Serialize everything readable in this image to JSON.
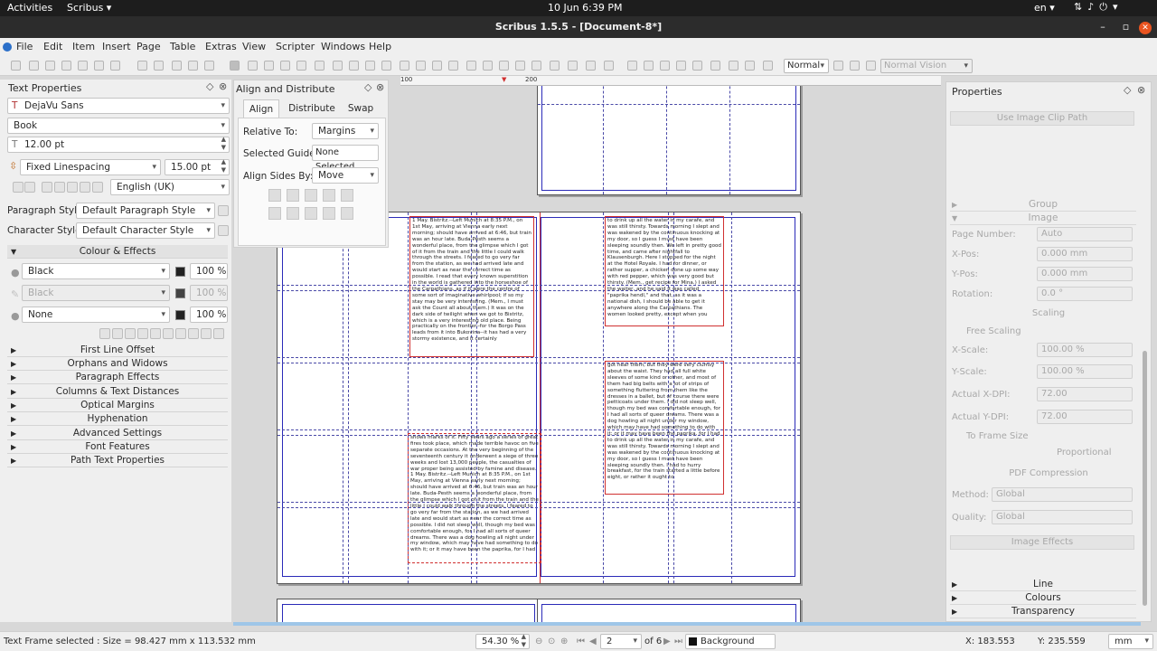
{
  "topbar": {
    "activities": "Activities",
    "app": "Scribus ▾",
    "clock": "10 Jun  6:39 PM",
    "lang": "en ▾",
    "tray_icons": [
      "network-icon",
      "volume-icon",
      "power-icon",
      "menu-caret-icon"
    ]
  },
  "window": {
    "title": "Scribus 1.5.5 - [Document-8*]"
  },
  "menubar": {
    "items": [
      "File",
      "Edit",
      "Item",
      "Insert",
      "Page",
      "Table",
      "Extras",
      "View",
      "Scripter",
      "Windows",
      "Help"
    ]
  },
  "toolbar": {
    "mode_select": "Normal",
    "vision_select": "Normal Vision"
  },
  "text_properties": {
    "title": "Text Properties",
    "font_family": "DejaVu Sans",
    "font_style": "Book",
    "font_size": "12.00 pt",
    "linespacing_mode": "Fixed Linespacing",
    "linespacing_value": "15.00 pt",
    "language": "English (UK)",
    "paragraph_style_label": "Paragraph Style:",
    "paragraph_style": "Default Paragraph Style",
    "character_style_label": "Character Style:",
    "character_style": "Default Character Style",
    "colour_effects": "Colour & Effects",
    "fill_color": "Black",
    "fill_shade": "100 %",
    "stroke_color": "Black",
    "stroke_shade": "100 %",
    "bg_color": "None",
    "bg_shade": "100 %",
    "sections": [
      "First Line Offset",
      "Orphans and Widows",
      "Paragraph Effects",
      "Columns & Text Distances",
      "Optical Margins",
      "Hyphenation",
      "Advanced Settings",
      "Font Features",
      "Path Text Properties"
    ]
  },
  "align_panel": {
    "title": "Align and Distribute",
    "tabs": [
      "Align",
      "Distribute",
      "Swap"
    ],
    "relative_to_label": "Relative To:",
    "relative_to": "Margins",
    "selected_guide_label": "Selected Guide:",
    "selected_guide": "None Selected",
    "align_sides_label": "Align Sides By:",
    "align_sides": "Move"
  },
  "ruler": {
    "ticks": [
      "100",
      "200"
    ]
  },
  "frames": {
    "frame_a": "1 May. Bistritz.--Left Munich at 8:35 P.M., on 1st May, arriving at Vienna early next morning; should have arrived at 6:46, but train was an hour late. Buda-Pesth seems a wonderful place, from the glimpse which I got of it from the train and the little I could walk through the streets. I feared to go very far from the station, as we had arrived late and would start as near the correct time as possible. I read that every known superstition in the world is gathered into the horseshoe of the Carpathians, as if it were the centre of some sort of imaginative whirlpool; if so my stay may be very interesting. (Mem., I must ask the Count all about them.) It was on the dark side of twilight when we got to Bistritz, which is a very interesting old place. Being practically on the frontier--for the Borgo Pass leads from it into Bukovina--it has had a very stormy existence, and it certainly",
    "frame_b": "to drink up all the water in my carafe, and was still thirsty. Towards morning I slept and was wakened by the continuous knocking at my door, so I guess I must have been sleeping soundly then. We left in pretty good time, and came after nightfall to Klausenburgh. Here I stopped for the night at the Hotel Royale. I had for dinner, or rather supper, a chicken done up some way with red pepper, which was very good but thirsty. (Mem., get recipe for Mina.) I asked the waiter, and he said it was called \"paprika hendl,\" and that, as it was a national dish, I should be able to get it anywhere along the Carpathians. The women looked pretty, except when you",
    "frame_c": "got near them, but they were very clumsy about the waist. They had all full white sleeves of some kind or other, and most of them had big belts with a lot of strips of something fluttering from them like the dresses in a ballet, but of course there were petticoats under them. I did not sleep well, though my bed was comfortable enough, for I had all sorts of queer dreams. There was a dog howling all night under my window, which may have had something to do with it; or it may have been the paprika, for I had to drink up all the water in my carafe, and was still thirsty. Towards morning I slept and was wakened by the continuous knocking at my door, so I guess I must have been sleeping soundly then. I had to hurry breakfast, for the train started a little before eight, or rather it ought to",
    "frame_d": "shows marks of it. Fifty years ago a series of great fires took place, which made terrible havoc on five separate occasions. At the very beginning of the seventeenth century it underwent a siege of three weeks and lost 13,000 people, the casualties of war proper being assisted by famine and disease. 1 May. Bistritz.--Left Munich at 8:35 P.M., on 1st May, arriving at Vienna early next morning; should have arrived at 6:46, but train was an hour late. Buda-Pesth seems a wonderful place, from the glimpse which I got of it from the train and the little I could walk through the streets. I feared to go very far from the station, as we had arrived late and would start as near the correct time as possible. I did not sleep well, though my bed was comfortable enough, for I had all sorts of queer dreams. There was a dog howling all night under my window, which may have had something to do with it; or it may have been the paprika, for I had"
  },
  "properties": {
    "title": "Properties",
    "use_clip_path": "Use Image Clip Path",
    "group": "Group",
    "image": "Image",
    "page_number_label": "Page Number:",
    "page_number": "Auto",
    "xpos_label": "X-Pos:",
    "xpos": "0.000 mm",
    "ypos_label": "Y-Pos:",
    "ypos": "0.000 mm",
    "rotation_label": "Rotation:",
    "rotation": "0.0 °",
    "scaling": "Scaling",
    "free_scaling": "Free Scaling",
    "xscale_label": "X-Scale:",
    "xscale": "100.00 %",
    "yscale_label": "Y-Scale:",
    "yscale": "100.00 %",
    "actual_xdpi_label": "Actual X-DPI:",
    "actual_xdpi": "72.00",
    "actual_ydpi_label": "Actual Y-DPI:",
    "actual_ydpi": "72.00",
    "to_frame_size": "To Frame Size",
    "proportional": "Proportional",
    "pdf_compression": "PDF Compression",
    "method_label": "Method:",
    "method": "Global",
    "quality_label": "Quality:",
    "quality": "Global",
    "image_effects": "Image Effects",
    "sections": [
      "Line",
      "Colours",
      "Transparency"
    ]
  },
  "status": {
    "text": "Text Frame selected : Size = 98.427 mm x 113.532 mm",
    "zoom": "54.30 %",
    "page": "2",
    "of_pages": "of 6",
    "layer": "Background",
    "x": "X: 183.553",
    "y": "Y: 235.559",
    "unit": "mm"
  }
}
